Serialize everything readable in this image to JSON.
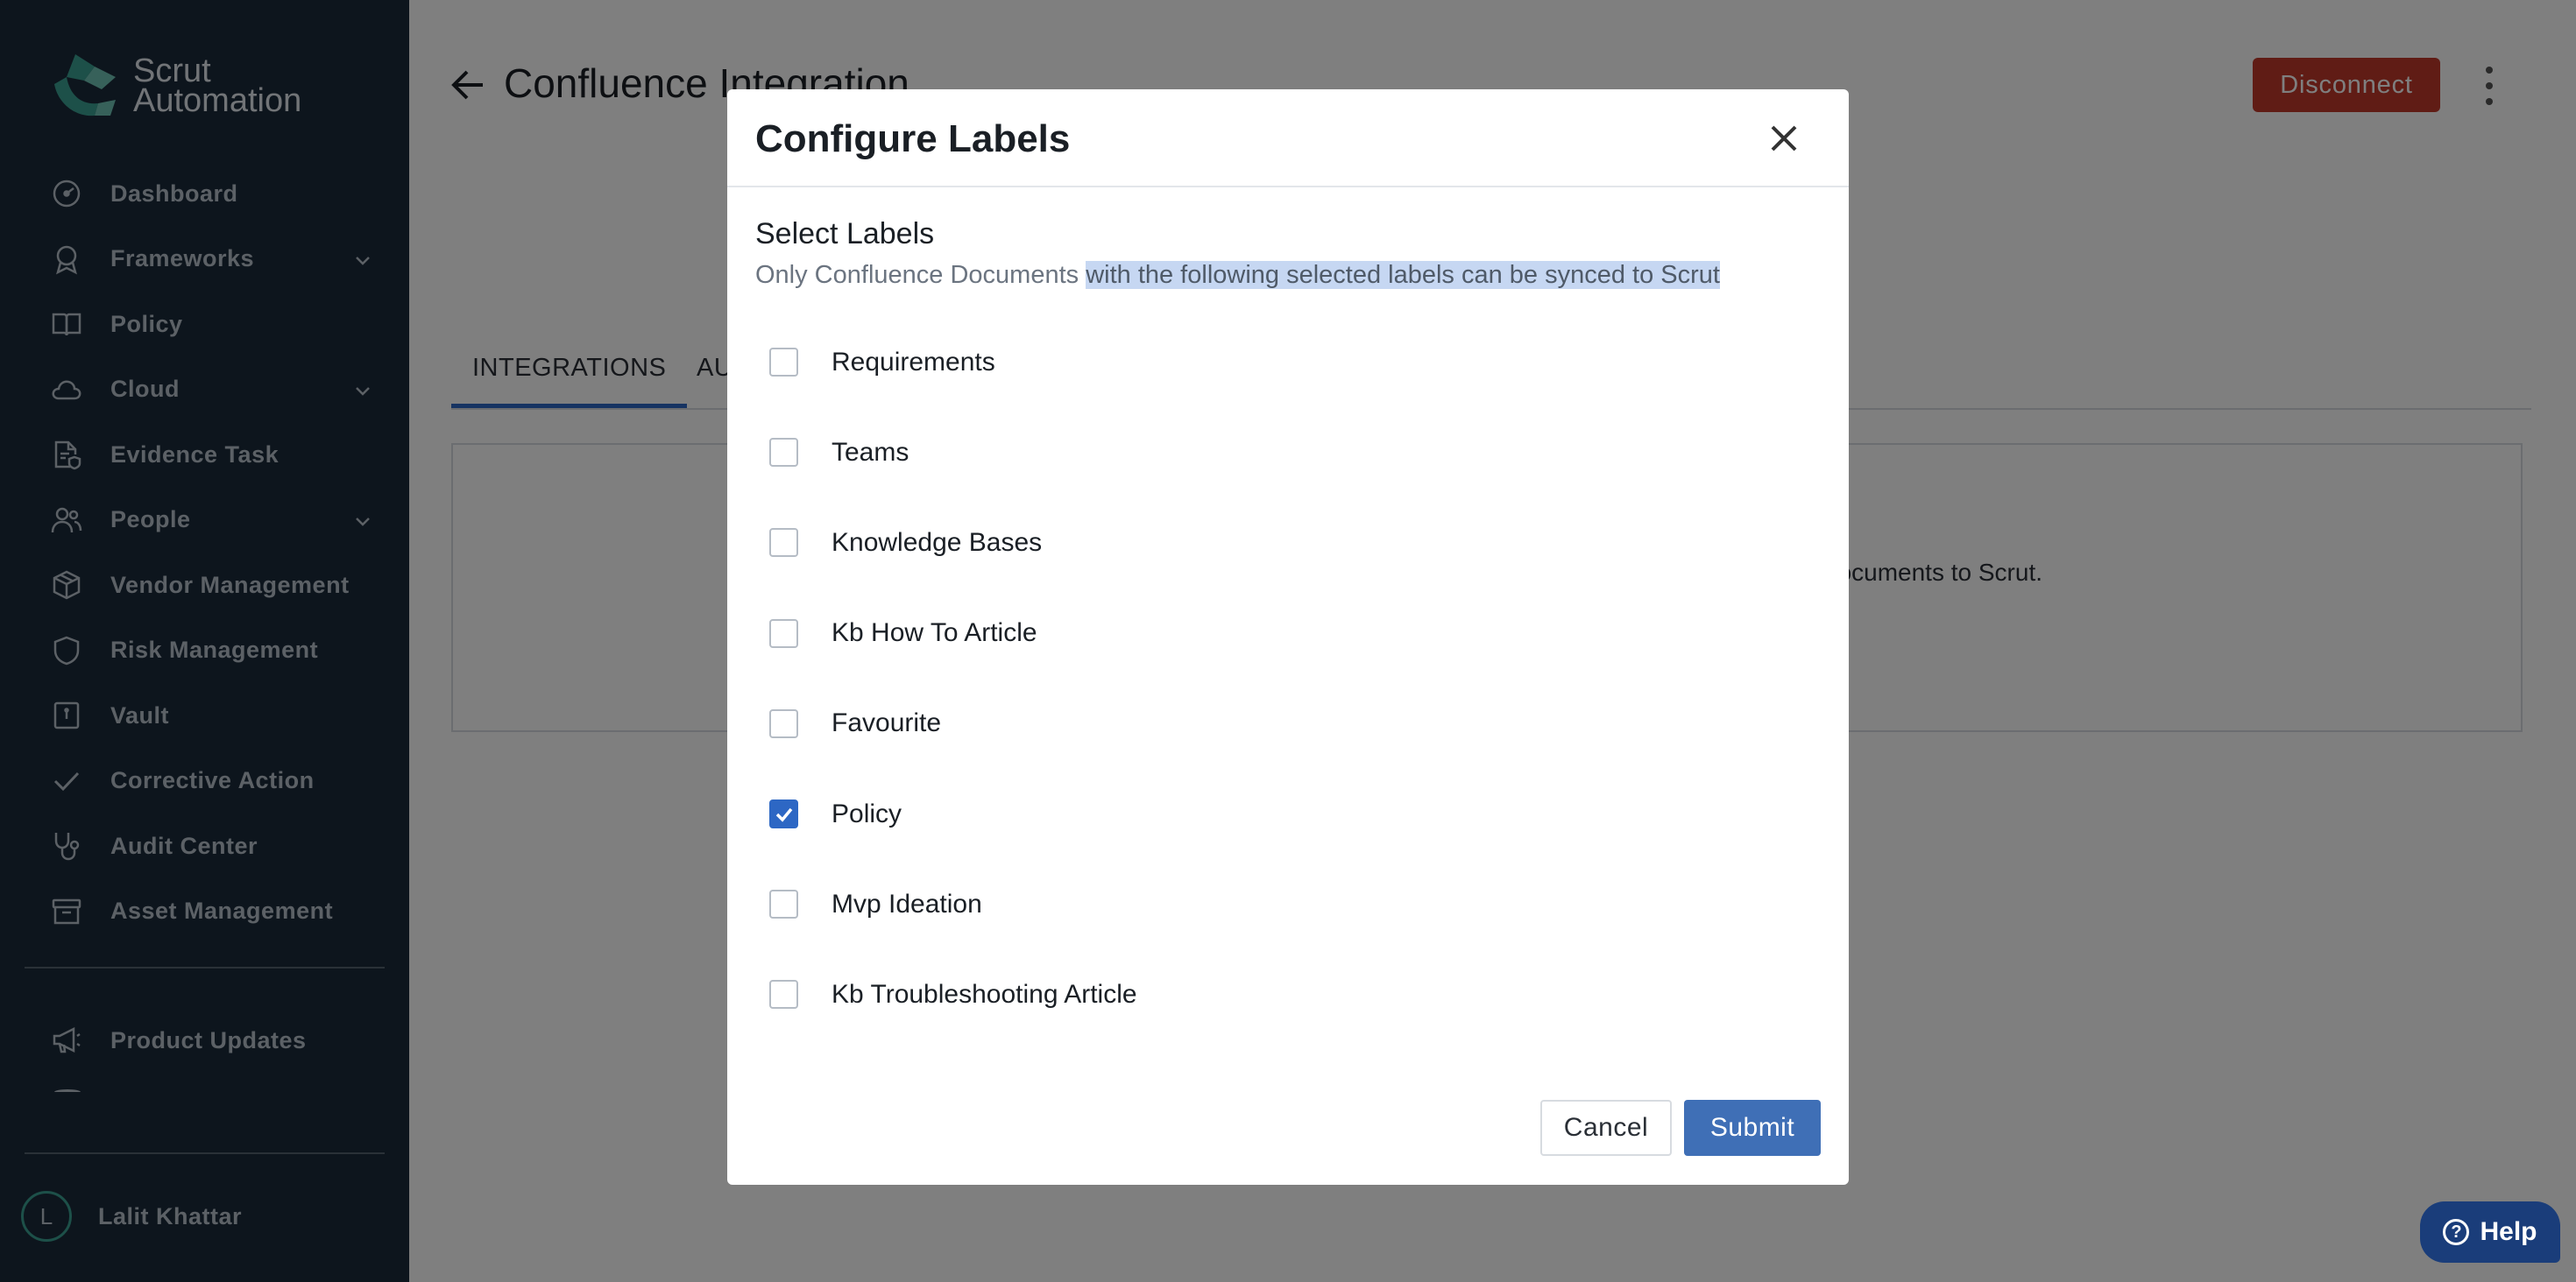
{
  "sidebar": {
    "logo": {
      "line1": "Scrut",
      "line2": "Automation"
    },
    "items": [
      {
        "label": "Dashboard",
        "icon": "dashboard-icon",
        "expandable": false
      },
      {
        "label": "Frameworks",
        "icon": "award-icon",
        "expandable": true
      },
      {
        "label": "Policy",
        "icon": "book-icon",
        "expandable": false
      },
      {
        "label": "Cloud",
        "icon": "cloud-icon",
        "expandable": true
      },
      {
        "label": "Evidence Task",
        "icon": "document-shield-icon",
        "expandable": false
      },
      {
        "label": "People",
        "icon": "people-icon",
        "expandable": true
      },
      {
        "label": "Vendor Management",
        "icon": "box-icon",
        "expandable": false
      },
      {
        "label": "Risk Management",
        "icon": "shield-icon",
        "expandable": false
      },
      {
        "label": "Vault",
        "icon": "vault-icon",
        "expandable": false
      },
      {
        "label": "Corrective Action",
        "icon": "check-icon",
        "expandable": false
      },
      {
        "label": "Audit Center",
        "icon": "stethoscope-icon",
        "expandable": false
      },
      {
        "label": "Asset Management",
        "icon": "archive-icon",
        "expandable": false
      }
    ],
    "product_updates": "Product Updates",
    "user": {
      "initial": "L",
      "name": "Lalit Khattar"
    }
  },
  "page": {
    "title": "Confluence Integration",
    "disconnect_label": "Disconnect",
    "tabs": [
      "INTEGRATIONS",
      "AU"
    ],
    "content_text": "documents to Scrut."
  },
  "modal": {
    "title": "Configure Labels",
    "section_title": "Select Labels",
    "description_plain": "Only Confluence Documents ",
    "description_highlighted": "with the following selected labels can be synced to Scrut",
    "labels": [
      {
        "label": "Requirements",
        "checked": false
      },
      {
        "label": "Teams",
        "checked": false
      },
      {
        "label": "Knowledge Bases",
        "checked": false
      },
      {
        "label": "Kb How To Article",
        "checked": false
      },
      {
        "label": "Favourite",
        "checked": false
      },
      {
        "label": "Policy",
        "checked": true
      },
      {
        "label": "Mvp Ideation",
        "checked": false
      },
      {
        "label": "Kb Troubleshooting Article",
        "checked": false
      }
    ],
    "cancel_label": "Cancel",
    "submit_label": "Submit"
  },
  "help": {
    "label": "Help"
  },
  "colors": {
    "sidebar_bg": "#1b2b3a",
    "accent_blue": "#2d67c4",
    "submit_blue": "#3f6fb6",
    "disconnect_red": "#c0392b",
    "brand_teal": "#3aa192",
    "help_bg": "#1a3d7a"
  }
}
